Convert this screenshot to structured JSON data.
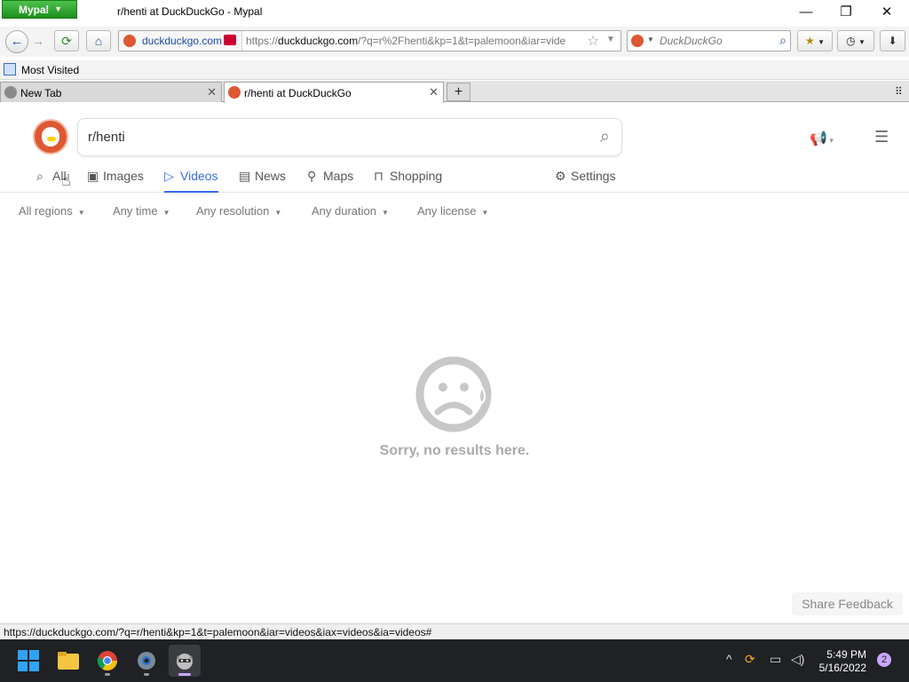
{
  "window": {
    "app_button": "Mypal",
    "title": "r/henti at DuckDuckGo - Mypal"
  },
  "navbar": {
    "identity_domain": "duckduckgo.com",
    "url_prefix": "https://",
    "url_domain": "duckduckgo.com",
    "url_rest": "/?q=r%2Fhenti&kp=1&t=palemoon&iar=vide",
    "search_placeholder": "DuckDuckGo"
  },
  "bookmarks": {
    "most_visited": "Most Visited"
  },
  "tabs": [
    {
      "label": "New Tab",
      "active": false
    },
    {
      "label": "r/henti at DuckDuckGo",
      "active": true
    }
  ],
  "ddg": {
    "query": "r/henti",
    "nav": [
      {
        "label": "All",
        "icon": "search-icon"
      },
      {
        "label": "Images",
        "icon": "image-icon"
      },
      {
        "label": "Videos",
        "icon": "play-icon",
        "active": true
      },
      {
        "label": "News",
        "icon": "news-icon"
      },
      {
        "label": "Maps",
        "icon": "map-pin-icon"
      },
      {
        "label": "Shopping",
        "icon": "shopping-bag-icon"
      }
    ],
    "settings_label": "Settings",
    "filters": [
      "All regions",
      "Any time",
      "Any resolution",
      "Any duration",
      "Any license"
    ],
    "no_results": "Sorry, no results here.",
    "feedback": "Share Feedback"
  },
  "status_url": "https://duckduckgo.com/?q=r/henti&kp=1&t=palemoon&iar=videos&iax=videos&ia=videos#",
  "taskbar": {
    "time": "5:49 PM",
    "date": "5/16/2022",
    "notifications": "2"
  },
  "colors": {
    "accent": "#3969ef",
    "ddg_orange": "#de5833"
  }
}
